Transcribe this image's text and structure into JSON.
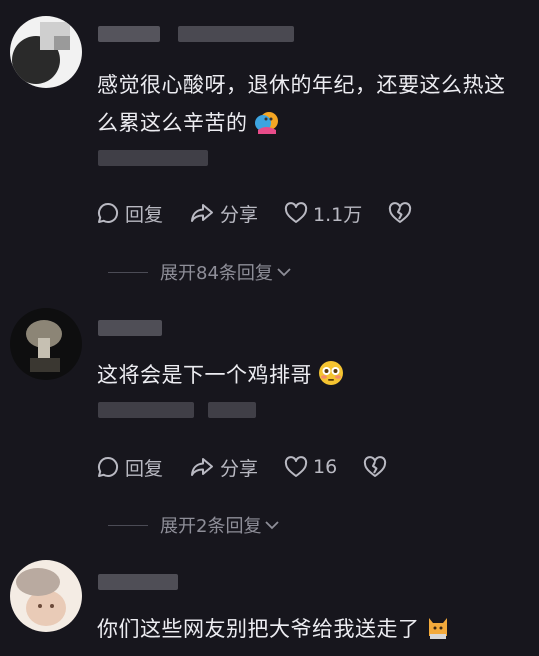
{
  "comments": [
    {
      "text_line1": "感觉很心酸呀，退休的年纪，还要这么热这",
      "text_line2": "么累这么辛苦的",
      "emoji": "hugging-face-emoji",
      "reply_label": "回复",
      "share_label": "分享",
      "like_count": "1.1万",
      "expand_label": "展开84条回复"
    },
    {
      "text": "这将会是下一个鸡排哥",
      "emoji": "flushed-face-emoji",
      "reply_label": "回复",
      "share_label": "分享",
      "like_count": "16",
      "expand_label": "展开2条回复"
    },
    {
      "text": "你们这些网友别把大爷给我送走了",
      "emoji": "cat-sticker-emoji"
    }
  ],
  "colors": {
    "background": "#17161d",
    "text": "#ececf1",
    "muted": "#b9b9c2",
    "expand": "#8e8e98"
  }
}
